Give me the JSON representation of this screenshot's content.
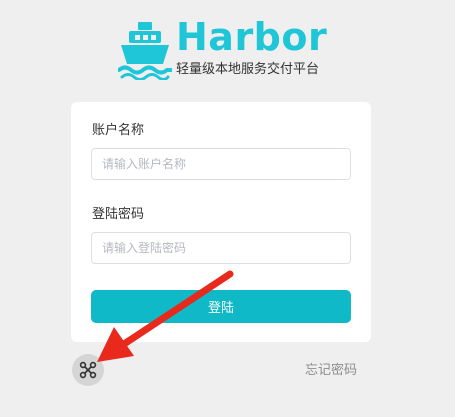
{
  "brand": {
    "title": "Harbor",
    "subtitle": "轻量级本地服务交付平台",
    "icon": "ship-icon",
    "color": "#1ec6d8"
  },
  "login_form": {
    "account_label": "账户名称",
    "account_placeholder": "请输入账户名称",
    "account_value": "",
    "password_label": "登陆密码",
    "password_placeholder": "请输入登陆密码",
    "password_value": "",
    "submit_label": "登陆",
    "submit_color": "#0fb9c7"
  },
  "footer": {
    "oidc_icon": "network-nodes-icon",
    "forgot_password_label": "忘记密码"
  },
  "annotation": {
    "arrow_color": "#e8291c",
    "points_to": "oidc-login-button"
  }
}
